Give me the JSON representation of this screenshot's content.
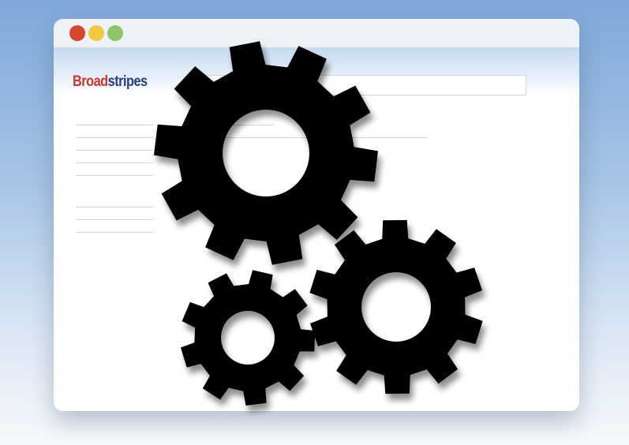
{
  "window": {
    "controls": [
      "close-dot",
      "minimize-dot",
      "maximize-dot"
    ],
    "colors": {
      "close": "#d9452f",
      "minimize": "#f4c83f",
      "maximize": "#8fc56a"
    }
  },
  "header": {
    "logo": {
      "part1": "Broad",
      "part2": "stripes",
      "color1": "#c8372d",
      "color2": "#243f8a"
    },
    "address_bar_value": ""
  },
  "overlay": {
    "icon": "gears-icon",
    "gear_count": 3,
    "color": "#000000"
  }
}
